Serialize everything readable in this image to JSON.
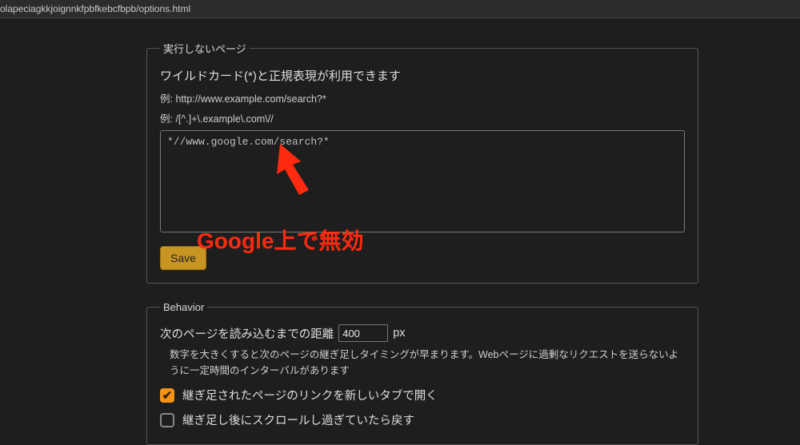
{
  "topbar": {
    "url_fragment": "olapeciagkkjoignnkfpbfkebcfbpb/options.html"
  },
  "exclude": {
    "legend": "実行しないページ",
    "description": "ワイルドカード(*)と正規表現が利用できます",
    "example1": "例: http://www.example.com/search?*",
    "example2": "例: /[^.]+\\.example\\.com\\//",
    "textarea_value": "*//www.google.com/search?*",
    "save_label": "Save"
  },
  "annotation": {
    "text": "Google上で無効"
  },
  "behavior": {
    "legend": "Behavior",
    "distance_label": "次のページを読み込むまでの距離",
    "distance_value": "400",
    "distance_unit": "px",
    "distance_help": "数字を大きくすると次のページの継ぎ足しタイミングが早まります。Webページに過剰なリクエストを送らないように一定時間のインターバルがあります",
    "check_newtab": "継ぎ足されたページのリンクを新しいタブで開く",
    "check_scrollback": "継ぎ足し後にスクロールし過ぎていたら戻す"
  }
}
